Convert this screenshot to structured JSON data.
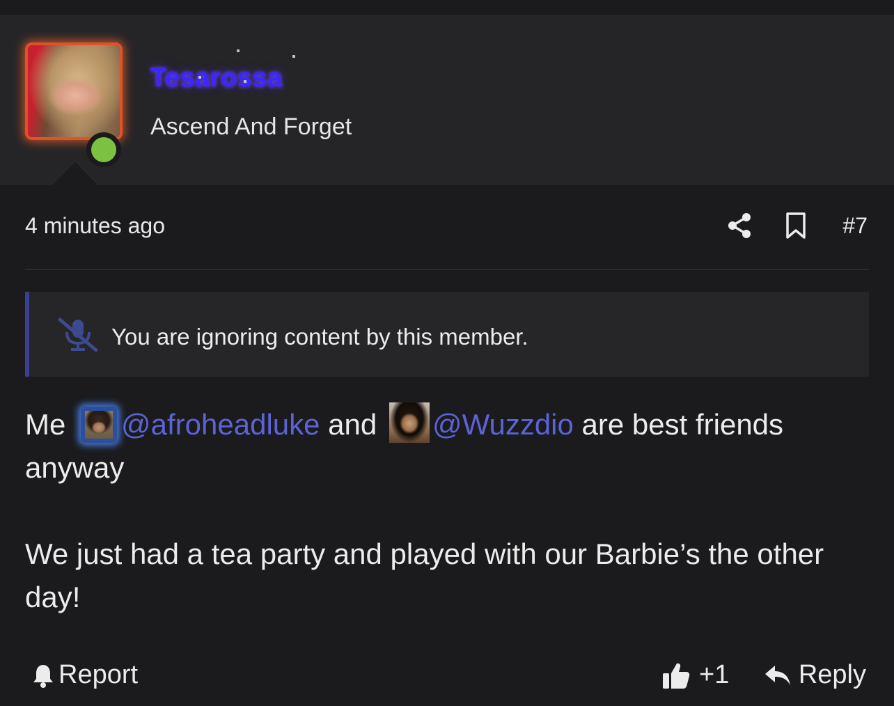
{
  "user": {
    "name": "Tesarossa",
    "title": "Ascend And Forget",
    "online": true,
    "name_color": "#3b26ff",
    "avatar_border_color": "#e0532a",
    "online_color": "#7dc142"
  },
  "post": {
    "timestamp": "4 minutes ago",
    "number": "#7",
    "ignore_notice": "You are ignoring content by this member.",
    "body": {
      "p1_start": "Me ",
      "mention1": "@afroheadluke",
      "p1_mid": " and ",
      "mention2": "@Wuzzdio",
      "p1_end": " are best friends anyway",
      "p2": "We just had a tea party and played with our Barbie’s the other day!"
    },
    "mention_color": "#5b63d6"
  },
  "actions": {
    "report": "Report",
    "like_count": "+1",
    "reply": "Reply"
  },
  "icons": {
    "share": "share-icon",
    "bookmark": "bookmark-icon",
    "mute": "microphone-slash-icon",
    "report": "bell-icon",
    "like": "thumbs-up-icon",
    "reply": "reply-arrow-icon"
  }
}
